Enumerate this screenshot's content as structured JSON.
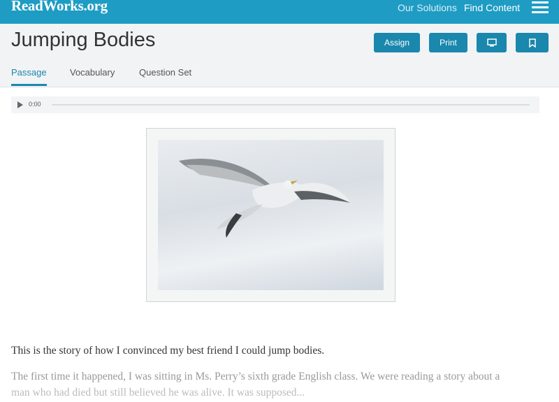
{
  "header": {
    "logo": "ReadWorks.org",
    "nav": [
      "Our Solutions",
      "Find Content"
    ]
  },
  "title": "Jumping Bodies",
  "actions": {
    "assign": "Assign",
    "print": "Print"
  },
  "tabs": [
    "Passage",
    "Vocabulary",
    "Question Set"
  ],
  "audio": {
    "time": "0:00"
  },
  "passage": [
    "This is the story of how I convinced my best friend I could jump bodies.",
    "The first time it happened, I was sitting in Ms. Perry’s sixth grade English class. We were reading a story about a",
    "man who had died but still believed he was alive. It was supposed..."
  ],
  "icons": [
    "menu-icon",
    "monitor-icon",
    "bookmark-icon",
    "play-icon"
  ],
  "colors": {
    "header": "#1e9cc4",
    "accent": "#1a87ad"
  }
}
